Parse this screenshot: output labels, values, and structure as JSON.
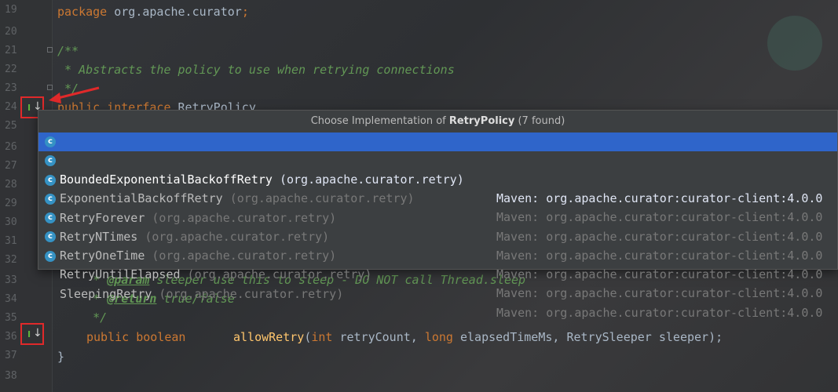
{
  "lines": [
    {
      "n": "19"
    },
    {
      "n": "20"
    },
    {
      "n": "21"
    },
    {
      "n": "22"
    },
    {
      "n": "23"
    },
    {
      "n": "24"
    },
    {
      "n": "25"
    },
    {
      "n": "26"
    },
    {
      "n": "27"
    },
    {
      "n": "28"
    },
    {
      "n": "29"
    },
    {
      "n": "30"
    },
    {
      "n": "31"
    },
    {
      "n": "32"
    },
    {
      "n": "33"
    },
    {
      "n": "34"
    },
    {
      "n": "35"
    },
    {
      "n": "36"
    },
    {
      "n": "37"
    },
    {
      "n": "38"
    }
  ],
  "code": {
    "package_kw": "package",
    "package_name": " org.apache.curator",
    "semicolon": ";",
    "javadoc_open": "/**",
    "javadoc_line": " * Abstracts the policy to use when retrying connections",
    "javadoc_close": " */",
    "iface_kw": "public interface",
    "iface_name": " RetryPolicy",
    "param_prefix": "     * ",
    "param_tag": "@param",
    "param_text": " sleeper use this to sleep - DO NOT call Thread.sleep",
    "return_prefix": "     * ",
    "return_tag": "@return",
    "return_text": " true/false",
    "close_comment": "     */",
    "method_kw": "public boolean",
    "method_name": "allowRetry",
    "method_open": "(",
    "int_kw": "int",
    "p1": " retryCount, ",
    "long_kw": "long",
    "p2": " elapsedTimeMs, RetrySleeper sleeper);",
    "brace": "}"
  },
  "gutter_icon": {
    "letter": "I",
    "arrow": "↓",
    "icon": "implemented-interface-icon"
  },
  "popup": {
    "title_prefix": "Choose Implementation of ",
    "title_class": "RetryPolicy",
    "title_suffix": " (7 found)",
    "items": [
      {
        "name": "BoundedExponentialBackoffRetry",
        "pkg": " (org.apache.curator.retry)",
        "maven": "Maven: org.apache.curator:curator-client:4.0.0",
        "selected": true
      },
      {
        "name": "ExponentialBackoffRetry",
        "pkg": " (org.apache.curator.retry)",
        "maven": "Maven: org.apache.curator:curator-client:4.0.0"
      },
      {
        "name": "RetryForever",
        "pkg": " (org.apache.curator.retry)",
        "maven": "Maven: org.apache.curator:curator-client:4.0.0"
      },
      {
        "name": "RetryNTimes",
        "pkg": " (org.apache.curator.retry)",
        "maven": "Maven: org.apache.curator:curator-client:4.0.0"
      },
      {
        "name": "RetryOneTime",
        "pkg": " (org.apache.curator.retry)",
        "maven": "Maven: org.apache.curator:curator-client:4.0.0"
      },
      {
        "name": "RetryUntilElapsed",
        "pkg": " (org.apache.curator.retry)",
        "maven": "Maven: org.apache.curator:curator-client:4.0.0"
      },
      {
        "name": "SleepingRetry",
        "pkg": " (org.apache.curator.retry)",
        "maven": "Maven: org.apache.curator:curator-client:4.0.0"
      }
    ],
    "class_icon_letter": "c"
  },
  "colors": {
    "selection": "#2f65ca",
    "annotation_box": "#e0292a",
    "keyword": "#cc7832",
    "comment": "#629755"
  }
}
